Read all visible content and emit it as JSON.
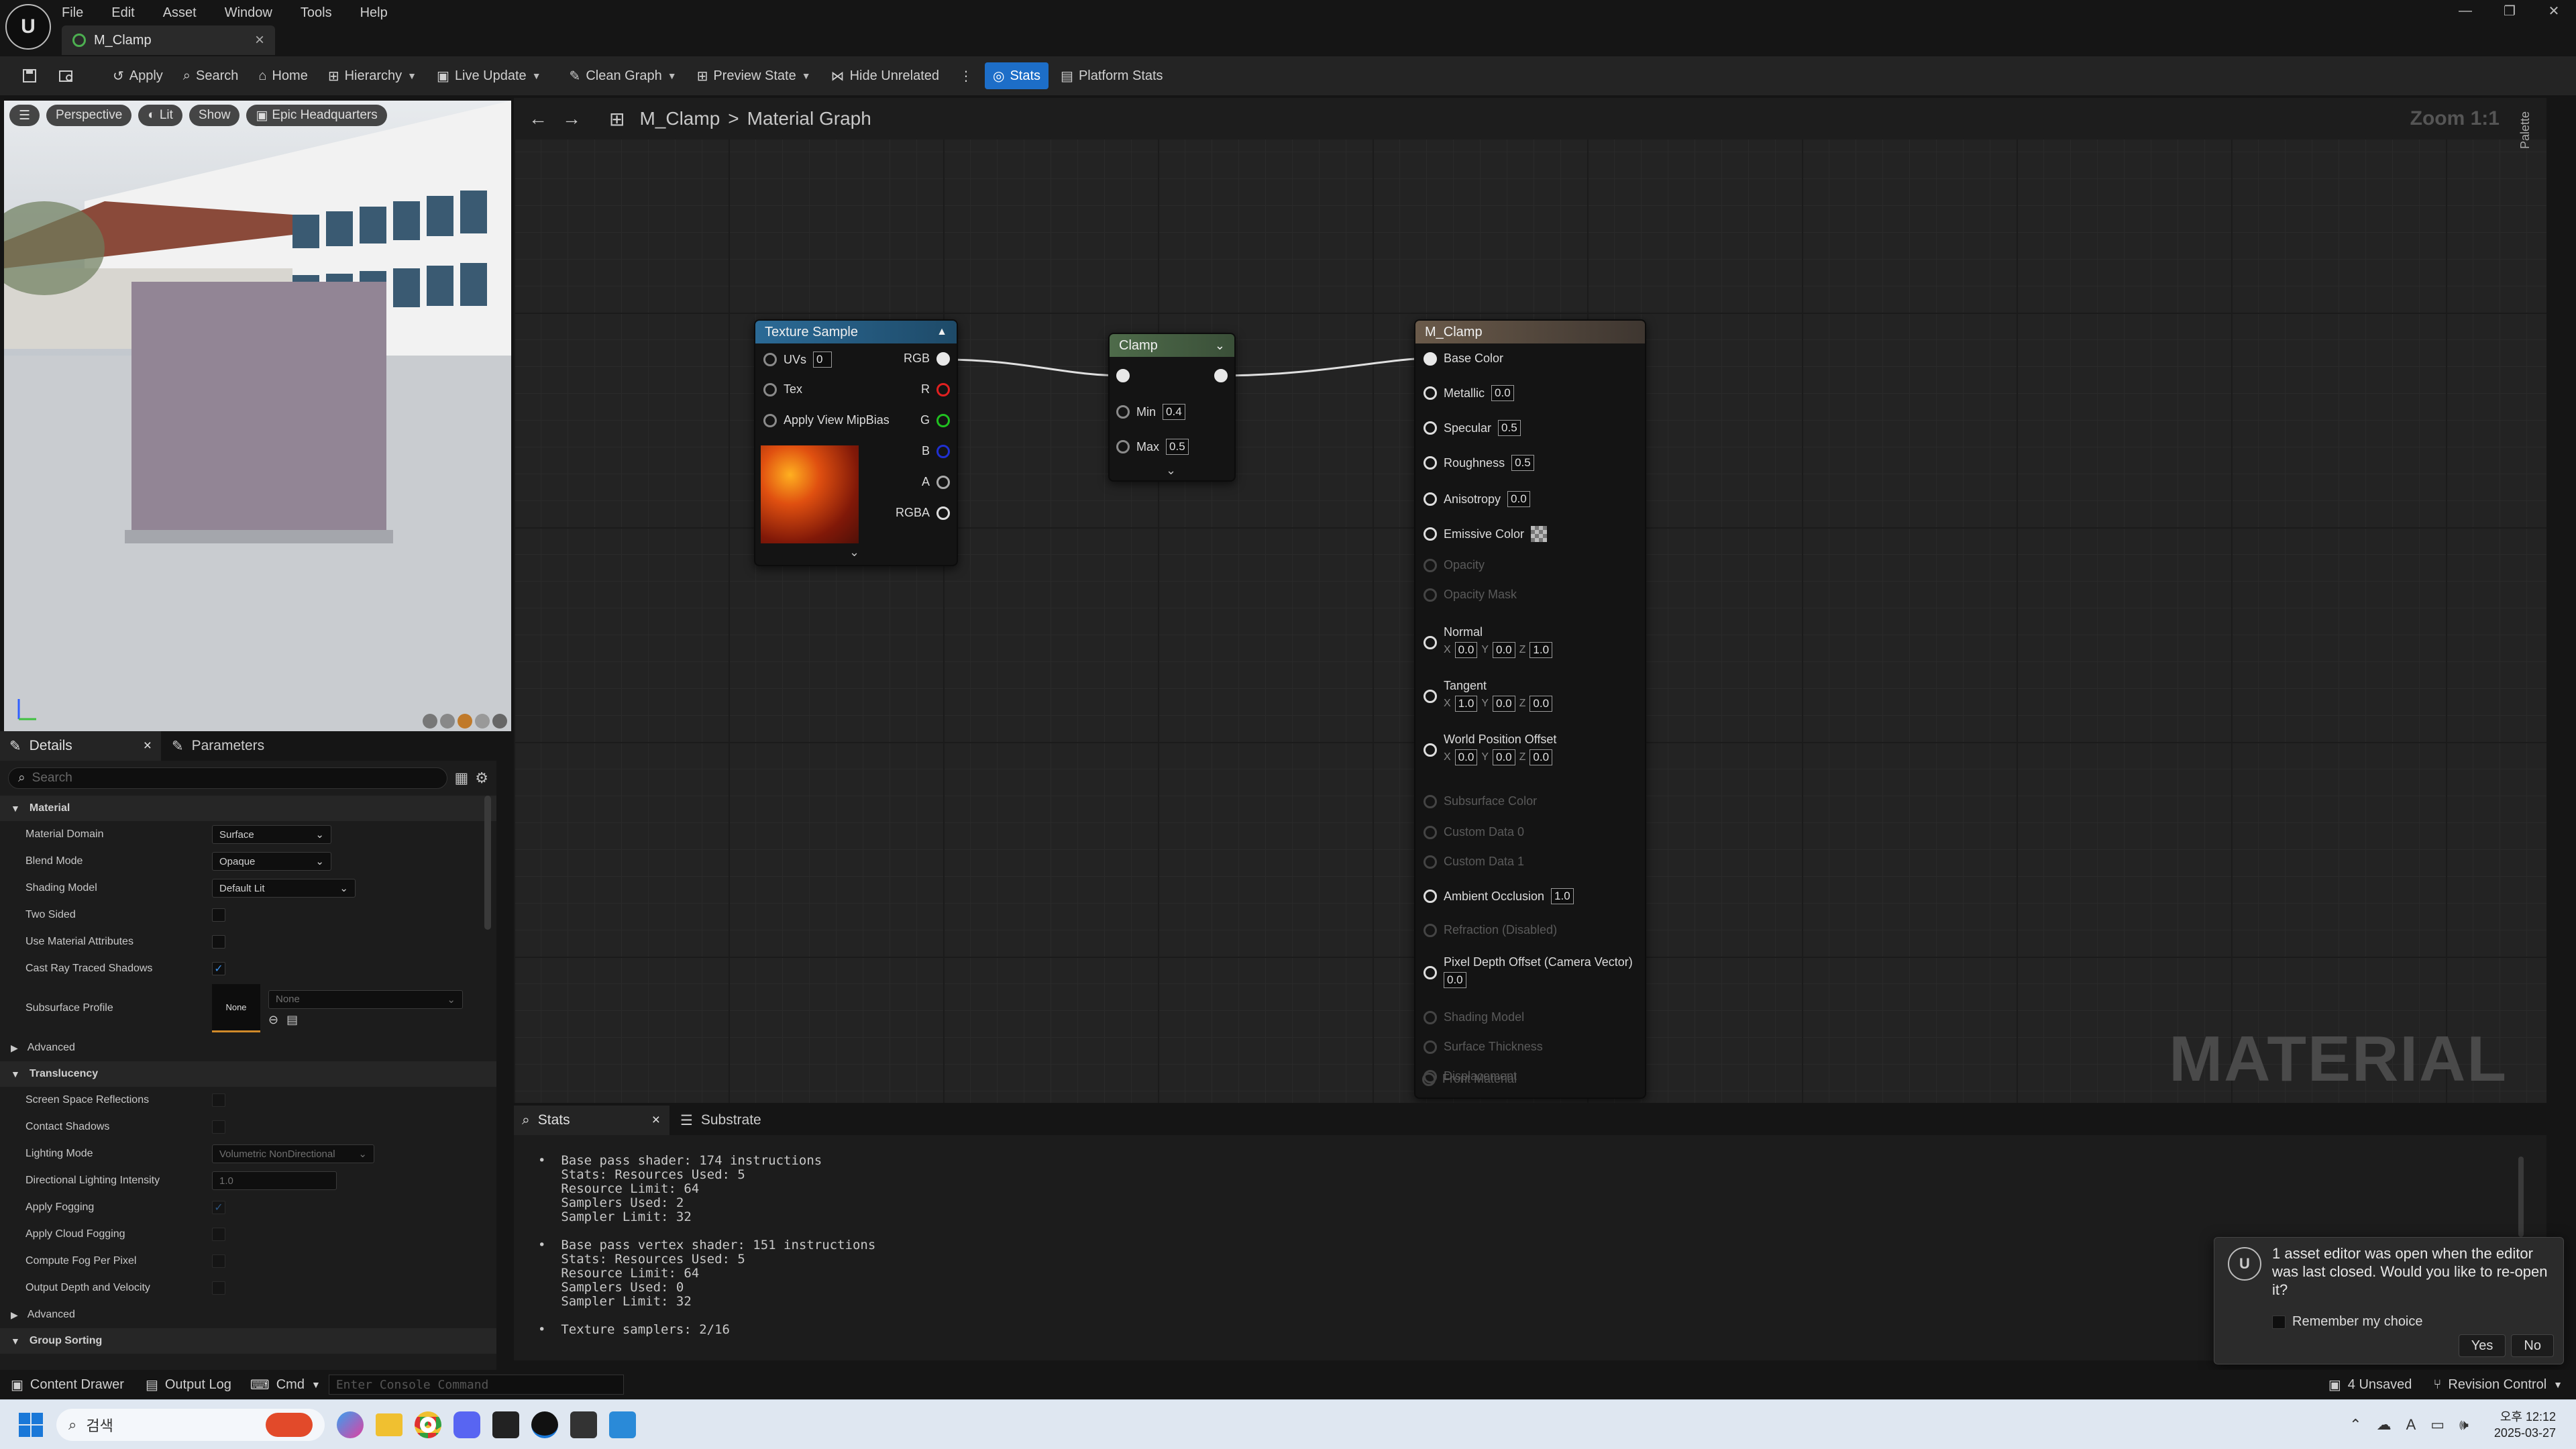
{
  "menu": [
    "File",
    "Edit",
    "Asset",
    "Window",
    "Tools",
    "Help"
  ],
  "doc_tab": {
    "title": "M_Clamp",
    "close": "×"
  },
  "window_controls": {
    "minimize": "—",
    "restore": "❐",
    "close": "✕"
  },
  "toolbar": {
    "apply": "Apply",
    "search": "Search",
    "home": "Home",
    "hierarchy": "Hierarchy",
    "live_update": "Live Update",
    "clean_graph": "Clean Graph",
    "preview_state": "Preview State",
    "hide_unrelated": "Hide Unrelated",
    "stats": "Stats",
    "platform_stats": "Platform Stats"
  },
  "viewport": {
    "perspective": "Perspective",
    "lit": "Lit",
    "show": "Show",
    "environment": "Epic Headquarters"
  },
  "details": {
    "tab_details": "Details",
    "tab_parameters": "Parameters",
    "search_placeholder": "Search",
    "cat_material": "Material",
    "material_domain_label": "Material Domain",
    "material_domain_value": "Surface",
    "blend_mode_label": "Blend Mode",
    "blend_mode_value": "Opaque",
    "shading_model_label": "Shading Model",
    "shading_model_value": "Default Lit",
    "two_sided": "Two Sided",
    "use_material_attributes": "Use Material Attributes",
    "cast_ray_traced_shadows": "Cast Ray Traced Shadows",
    "subsurface_profile": "Subsurface Profile",
    "subsurface_thumb": "None",
    "subsurface_value": "None",
    "advanced": "Advanced",
    "cat_translucency": "Translucency",
    "screen_space_reflections": "Screen Space Reflections",
    "contact_shadows": "Contact Shadows",
    "lighting_mode_label": "Lighting Mode",
    "lighting_mode_value": "Volumetric NonDirectional",
    "directional_lighting_intensity": "Directional Lighting Intensity",
    "directional_lighting_value": "1.0",
    "apply_fogging": "Apply Fogging",
    "apply_cloud_fogging": "Apply Cloud Fogging",
    "compute_fog_per_pixel": "Compute Fog Per Pixel",
    "output_depth_velocity": "Output Depth and Velocity",
    "advanced2": "Advanced",
    "cat_group_sorting": "Group Sorting"
  },
  "graph": {
    "breadcrumb_asset": "M_Clamp",
    "breadcrumb_sep": ">",
    "breadcrumb_graph": "Material Graph",
    "zoom": "Zoom 1:1",
    "watermark": "MATERIAL",
    "palette": "Palette"
  },
  "texture_node": {
    "title": "Texture Sample",
    "uvs": "UVs",
    "uvs_value": "0",
    "tex": "Tex",
    "mip": "Apply View MipBias",
    "out_rgb": "RGB",
    "out_r": "R",
    "out_g": "G",
    "out_b": "B",
    "out_a": "A",
    "out_rgba": "RGBA"
  },
  "clamp_node": {
    "title": "Clamp",
    "min": "Min",
    "min_value": "0.4",
    "max": "Max",
    "max_value": "0.5"
  },
  "result_node": {
    "title": "M_Clamp",
    "base_color": "Base Color",
    "metallic": "Metallic",
    "metallic_value": "0.0",
    "specular": "Specular",
    "specular_value": "0.5",
    "roughness": "Roughness",
    "roughness_value": "0.5",
    "anisotropy": "Anisotropy",
    "anisotropy_value": "0.0",
    "emissive": "Emissive Color",
    "opacity": "Opacity",
    "opacity_mask": "Opacity Mask",
    "normal": "Normal",
    "normal_x": "0.0",
    "normal_y": "0.0",
    "normal_z": "1.0",
    "tangent": "Tangent",
    "tangent_x": "1.0",
    "tangent_y": "0.0",
    "tangent_z": "0.0",
    "wpo": "World Position Offset",
    "wpo_x": "0.0",
    "wpo_y": "0.0",
    "wpo_z": "0.0",
    "subsurface_color": "Subsurface Color",
    "custom0": "Custom Data 0",
    "custom1": "Custom Data 1",
    "ao": "Ambient Occlusion",
    "ao_value": "1.0",
    "refraction": "Refraction (Disabled)",
    "pdo": "Pixel Depth Offset (Camera Vector)",
    "pdo_value": "0.0",
    "shading_model": "Shading Model",
    "surface_thickness": "Surface Thickness",
    "displacement": "Displacement",
    "front_material": "Front Material"
  },
  "stats_panel": {
    "tab_stats": "Stats",
    "tab_substrate": "Substrate",
    "body": "•  Base pass shader: 174 instructions\n   Stats: Resources Used: 5\n   Resource Limit: 64\n   Samplers Used: 2\n   Sampler Limit: 32\n\n•  Base pass vertex shader: 151 instructions\n   Stats: Resources Used: 5\n   Resource Limit: 64\n   Samplers Used: 0\n   Sampler Limit: 32\n\n•  Texture samplers: 2/16"
  },
  "notification": {
    "text": "1 asset editor was open when the editor was last closed. Would you like to re-open it?",
    "remember": "Remember my choice",
    "yes": "Yes",
    "no": "No"
  },
  "statusbar": {
    "content_drawer": "Content Drawer",
    "output_log": "Output Log",
    "cmd": "Cmd",
    "console_placeholder": "Enter Console Command",
    "unsaved": "4 Unsaved",
    "revision_control": "Revision Control"
  },
  "taskbar": {
    "search": "검색",
    "time": "오후 12:12",
    "date": "2025-03-27"
  },
  "colors": {
    "accent": "#1d6ec8",
    "texture_header": "#2b6a96",
    "clamp_header": "#4e6b4a",
    "result_header": "#6a5a4a"
  }
}
